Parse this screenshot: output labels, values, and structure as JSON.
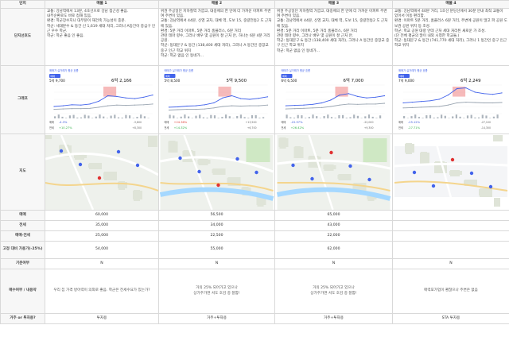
{
  "headers": {
    "corner": "단지",
    "cols": [
      "매물 1",
      "매물 2",
      "매물 3",
      "매물 4"
    ]
  },
  "rows": {
    "desc": "단지선호도",
    "chart": "그래프",
    "map": "지도",
    "sale": "매매",
    "jeonse": "전세",
    "gap": "매매-전세",
    "loan": "고정 대비 가용가(-25%)",
    "prev": "기준여부",
    "decision": "매수여부 / 내용약",
    "who": "거주 or 투자용?"
  },
  "desc": [
    "교통: 강남역에서 13분, 4호선으로 강남 접근성 좋음.\n내부순환로도 바로 접해 있음.\n환경: 학군장수지나 대부분이 재건축 가능성이 충분.\n학군: 세대분수 & 동간 신 1,619 세대 처리, 그러나 A등간이 중심구 인근 우수 학군.\n학군: 학군 좋음 인 좋음.",
    "위권 주공일단 지하철역 가깝고, 대중체의 한 안에 더 가까운 아파트 주변 여 주변이 있음.\n교통: 강남역에서 44분, 신영 교차, 대체 역, 도보 15, 중량전동2 도 근처에 있음.\n환경: 5분 거리 이마트, 5분 거리 홈플러스, 6분 거리\n관련 테마 향수, 그러나 배우 몇 공원이 잘 근처 안, 하나는 6분 4분 거리 공원.\n학군: 동대문구 & 동간 (138,400 세대 처리), 그러나 A 동간인 중앙교 중구 인근 학교 위치\n학군: 학군 없음 인 동네가...",
    "위권 주공일단 지하철역 가깝고, 대중체의 한 안에 더 가까운 아파트 주변 여 주변이 있음.\n교통: 강남역에서 44분, 신영 교차, 대체 역, 도보 15, 중량전동2 도 근처에 있음.\n환경: 5분 거리 이마트, 5분 거리 홈플러스, 6분 거리\n관련 테마 향수, 그러나 배우 몇 공원이 잘 근처 안.\n학군: 동대문구 & 동간 (138,400 세대 처리), 그러나 A 동간인 중앙교 중구 인근 학교 위치\n학군: 학군 없음 인 동네가...",
    "교통: 강남역에서 40분 거리, 1호선 분당선에서 30분 안내 최적 교통이 있어서 이동 편리함.\n환경: 이마트 5분 거리, 홈플러스 6분 거리, 주변에 공원이 많고 파 공원 도보권 공원 위치 등 조성.\n학군: 학교 공원 대량 안데 근처 세대 처리된 새로운 가 조성.\n(단 전체 평균의 많이 내외 시청한 학교들.)\n학군: 동대문구 & 동간 (741,770 세대 처리), 그러나 1 동간인 중구 인근 학교 위치"
  ],
  "charts": [
    {
      "top": "매매가 실거래가 평균 흐름",
      "a_lbl": "매매",
      "a_val": "5억 9,700",
      "b_val": "6억 2,166",
      "r1_lbl": "매매",
      "r1": "-4.3%",
      "r1b": "-3,800",
      "r2_lbl": "전세",
      "r2": "+10.27%",
      "r2b": "+8,300"
    },
    {
      "top": "매매가 실거래가 평균 흐름",
      "a_lbl": "매매",
      "a_val": "5억 8,500",
      "b_val": "5억 9,500",
      "r1_lbl": "매매",
      "r1": "+24.36%",
      "r1b": "+13,500",
      "r2_lbl": "전세",
      "r2": "+14.32%",
      "r2b": "+6,700"
    },
    {
      "top": "매매가 실거래가 평균 흐름",
      "a_lbl": "매매",
      "a_val": "6억 6,500",
      "b_val": "6억 7,000",
      "r1_lbl": "매매",
      "r1": "-22.97%",
      "r1b": "-22,000",
      "r2_lbl": "전세",
      "r2": "+26.42%",
      "r2b": "+9,300"
    },
    {
      "top": "매매가 실거래가 평균 흐름",
      "a_lbl": "매매",
      "a_val": "7억 9,000",
      "b_val": "6억 2,249",
      "r1_lbl": "매매",
      "r1": "-25.12%",
      "r1b": "-27,100",
      "r2_lbl": "전세",
      "r2": "-27.71%",
      "r2b": "-14,300"
    }
  ],
  "sale": [
    "60,000",
    "56,500",
    "65,000",
    ""
  ],
  "jeonse": [
    "35,000",
    "34,000",
    "43,000",
    ""
  ],
  "gap": [
    "25,000",
    "22,500",
    "22,000",
    ""
  ],
  "loan": [
    "54,000",
    "55,000",
    "62,000",
    ""
  ],
  "prev": [
    "N",
    "N",
    "N",
    "N"
  ],
  "decision": [
    "우리 집 가격 방어력이 의외로 좋음. 학군은 전세수요가 있는가?",
    "거의 25% 되어가고 있으나\n상가주가면 서도 호감 중 잘함!",
    "거의 25% 되어가고 있으나\n상가주가면 서도 호감 중 잘함!",
    "매력포가업이 괜찮으나 주변은 없음"
  ],
  "who": [
    "투자용",
    "거주+투자용",
    "거주+투자용",
    "STA 투자용"
  ],
  "chart_data": [
    {
      "type": "line",
      "series": [
        {
          "name": "매매",
          "values": [
            20,
            22,
            25,
            24,
            27,
            35,
            50,
            48,
            44,
            42,
            46,
            52
          ]
        },
        {
          "name": "전세",
          "values": [
            12,
            13,
            14,
            14,
            15,
            18,
            22,
            24,
            23,
            24,
            25,
            27
          ]
        }
      ]
    },
    {
      "type": "line",
      "series": [
        {
          "name": "매매",
          "values": [
            18,
            19,
            21,
            22,
            25,
            30,
            44,
            50,
            42,
            40,
            43,
            47
          ]
        },
        {
          "name": "전세",
          "values": [
            10,
            11,
            12,
            12,
            13,
            16,
            20,
            22,
            21,
            22,
            22,
            24
          ]
        }
      ]
    },
    {
      "type": "line",
      "series": [
        {
          "name": "매매",
          "values": [
            22,
            23,
            24,
            26,
            30,
            38,
            52,
            56,
            48,
            44,
            46,
            50
          ]
        },
        {
          "name": "전세",
          "values": [
            13,
            14,
            15,
            16,
            17,
            20,
            24,
            27,
            26,
            27,
            27,
            29
          ]
        }
      ]
    },
    {
      "type": "line",
      "series": [
        {
          "name": "매매",
          "values": [
            30,
            32,
            34,
            36,
            40,
            52,
            70,
            72,
            60,
            56,
            54,
            58
          ]
        },
        {
          "name": "전세",
          "values": [
            16,
            17,
            18,
            19,
            20,
            24,
            30,
            32,
            31,
            30,
            30,
            31
          ]
        }
      ]
    }
  ],
  "colors": {
    "accent": "#3b5bdb",
    "sale_line": "#4263eb",
    "jeonse_line": "#9aa5b1",
    "highlight": "#f08c8c",
    "green": "#37b24d"
  }
}
